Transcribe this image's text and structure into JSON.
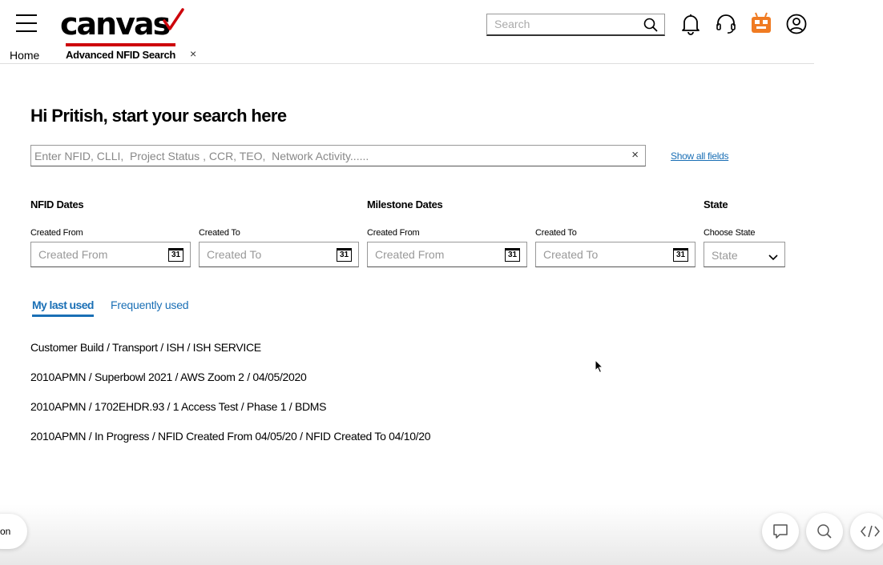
{
  "header": {
    "logo_text": "canvas",
    "search_placeholder": "Search",
    "colors": {
      "brand_red": "#cd040b",
      "bot_orange": "#f07b22",
      "link_blue": "#1a6fb5"
    },
    "icons": [
      "menu-icon",
      "search-icon",
      "bell-icon",
      "headset-icon",
      "bot-icon",
      "user-icon"
    ]
  },
  "tabs": {
    "home": "Home",
    "active": "Advanced NFID Search",
    "close": "×"
  },
  "main": {
    "greeting": "Hi Pritish, start your search here",
    "search_placeholder": "Enter NFID, CLLI,  Project Status , CCR, TEO,  Network Activity......",
    "clear": "×",
    "show_all": "Show all fields"
  },
  "filters": {
    "nfid_dates": {
      "title": "NFID Dates",
      "from_label": "Created From",
      "from_placeholder": "Created From",
      "to_label": "Created To",
      "to_placeholder": "Created To"
    },
    "milestone_dates": {
      "title": "Milestone Dates",
      "from_label": "Created From",
      "from_placeholder": "Created From",
      "to_label": "Created To",
      "to_placeholder": "Created To"
    },
    "state": {
      "title": "State",
      "label": "Choose State",
      "value": "State"
    },
    "calendar_day": "31"
  },
  "history": {
    "tab_active": "My last used",
    "tab_inactive": "Frequently used",
    "items": [
      "Customer Build / Transport / ISH / ISH SERVICE",
      "2010APMN / Superbowl 2021 / AWS Zoom 2 /  04/05/2020",
      "2010APMN / 1702EHDR.93 / 1 Access Test / Phase 1 / BDMS",
      "2010APMN / In Progress / NFID Created From 04/05/20 / NFID Created To 04/10/20"
    ]
  },
  "floating": {
    "left_pill_text": "on",
    "buttons": [
      "chat-icon",
      "search-icon",
      "code-icon"
    ]
  }
}
